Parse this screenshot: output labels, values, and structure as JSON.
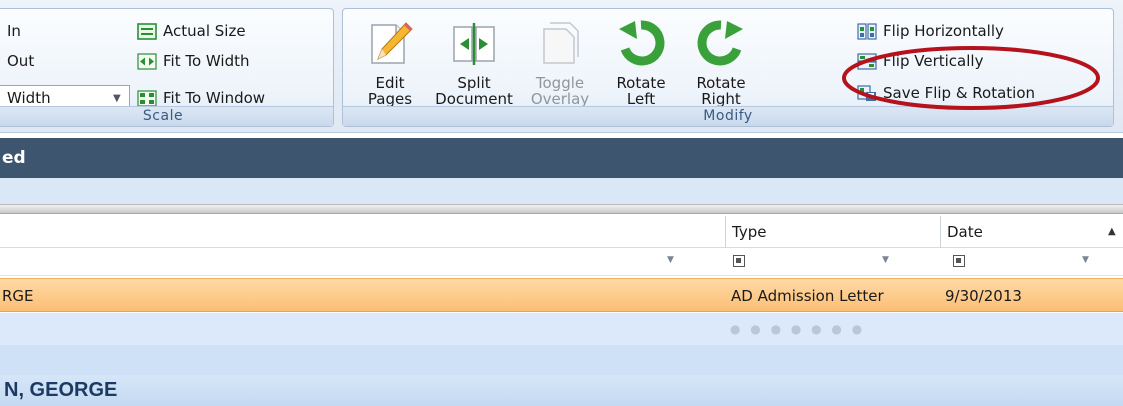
{
  "ribbon": {
    "scale": {
      "zoom_in": "In",
      "zoom_out": "Out",
      "width_combo": "Width",
      "actual_size": "Actual Size",
      "fit_to_width": "Fit To Width",
      "fit_to_window": "Fit To Window",
      "group_label": "Scale"
    },
    "modify": {
      "edit_pages": "Edit\nPages",
      "split_document": "Split\nDocument",
      "toggle_overlay": "Toggle\nOverlay",
      "rotate_left": "Rotate\nLeft",
      "rotate_right": "Rotate\nRight",
      "flip_horizontally": "Flip Horizontally",
      "flip_vertically": "Flip Vertically",
      "save_flip_rotation": "Save Flip & Rotation",
      "group_label": "Modify"
    }
  },
  "panel": {
    "title": "ed"
  },
  "grid": {
    "columns": [
      "Type",
      "Date"
    ],
    "selected_row": {
      "name": "RGE",
      "type": "AD Admission Letter",
      "date": "9/30/2013"
    },
    "group_footer": "N, GEORGE"
  },
  "colors": {
    "title_bar": "#3e556f",
    "selected_row": "#fbbf74",
    "annotation_circle": "#b5121b"
  },
  "icons": [
    "actual-size-icon",
    "fit-to-width-icon",
    "fit-to-window-icon",
    "edit-pages-icon",
    "split-document-icon",
    "toggle-overlay-icon",
    "rotate-left-icon",
    "rotate-right-icon",
    "flip-horizontally-icon",
    "flip-vertically-icon",
    "save-flip-rotation-icon"
  ]
}
